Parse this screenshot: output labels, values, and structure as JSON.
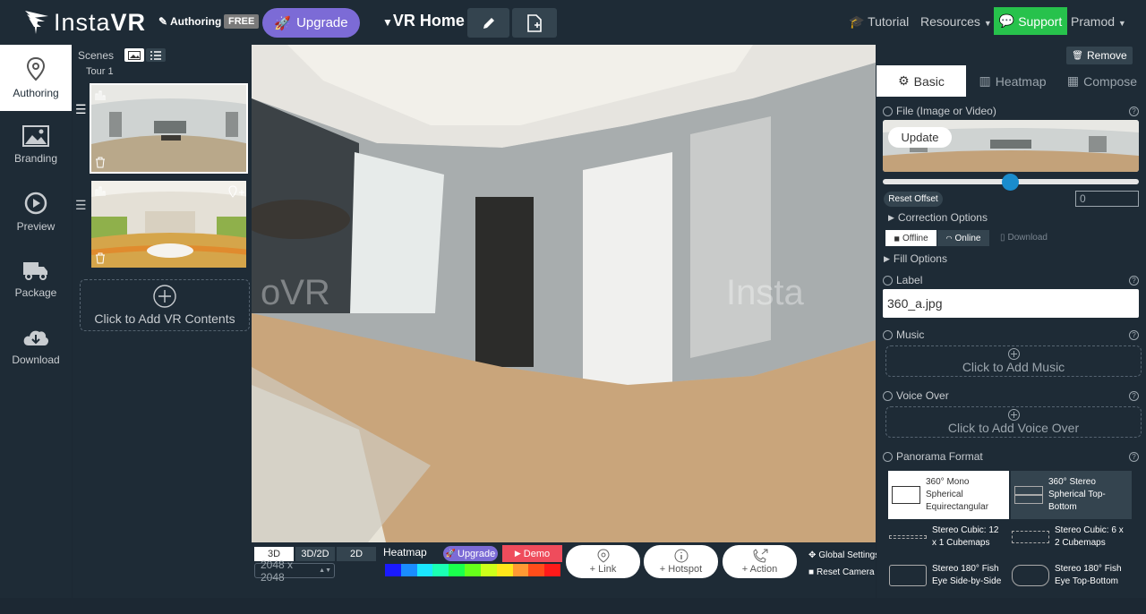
{
  "header": {
    "logo_light": "Insta",
    "logo_bold": "VR",
    "authoring_label": "Authoring",
    "plan_badge": "FREE",
    "upgrade_label": "Upgrade",
    "project_title": "VR Home",
    "tutorial_label": "Tutorial",
    "resources_label": "Resources",
    "support_label": "Support",
    "user_label": "Pramod"
  },
  "leftnav": {
    "items": [
      {
        "label": "Authoring",
        "icon": "map-pin-icon",
        "active": true
      },
      {
        "label": "Branding",
        "icon": "image-icon"
      },
      {
        "label": "Preview",
        "icon": "play-icon"
      },
      {
        "label": "Package",
        "icon": "truck-icon"
      },
      {
        "label": "Download",
        "icon": "cloud-download-icon"
      }
    ]
  },
  "scenes": {
    "title": "Scenes",
    "tour_label": "Tour 1",
    "add_label": "Click to Add VR Contents"
  },
  "viewport": {
    "watermark_left": "oVR",
    "watermark_right": "Insta"
  },
  "bottombar": {
    "mode_3d": "3D",
    "mode_3d2d": "3D/2D",
    "mode_2d": "2D",
    "resolution": "2048 x 2048",
    "heatmap_label": "Heatmap",
    "heatmap_upgrade": "Upgrade",
    "demo_label": "Demo",
    "link_label": "+ Link",
    "hotspot_label": "+ Hotspot",
    "action_label": "+ Action",
    "global_settings": "Global Settings",
    "reset_camera": "Reset Camera",
    "heat_colors": [
      "#1a1aff",
      "#1a8cff",
      "#1ae6ff",
      "#1affb3",
      "#1aff4d",
      "#66ff1a",
      "#ccff1a",
      "#ffe61a",
      "#ff9933",
      "#ff4d1a",
      "#ff1a1a"
    ]
  },
  "rpanel": {
    "remove_label": "Remove",
    "tabs": {
      "basic": "Basic",
      "heatmap": "Heatmap",
      "compose": "Compose"
    },
    "file_label": "File (Image or Video)",
    "update_label": "Update",
    "reset_offset": "Reset Offset",
    "offset_value": "0",
    "correction_options": "Correction Options",
    "offline_label": "Offline",
    "online_label": "Online",
    "download_label": "Download",
    "fill_options": "Fill Options",
    "label_title": "Label",
    "label_value": "360_a.jpg",
    "music_title": "Music",
    "music_add": "Click to Add Music",
    "voice_title": "Voice Over",
    "voice_add": "Click to Add Voice Over",
    "panorama_title": "Panorama Format",
    "formats": [
      "360° Mono Spherical Equirectangular",
      "360° Stereo Spherical Top-Bottom",
      "Stereo Cubic: 12 x 1 Cubemaps",
      "Stereo Cubic: 6 x 2 Cubemaps",
      "Stereo 180° Fish Eye Side-by-Side",
      "Stereo 180° Fish Eye Top-Bottom"
    ]
  }
}
